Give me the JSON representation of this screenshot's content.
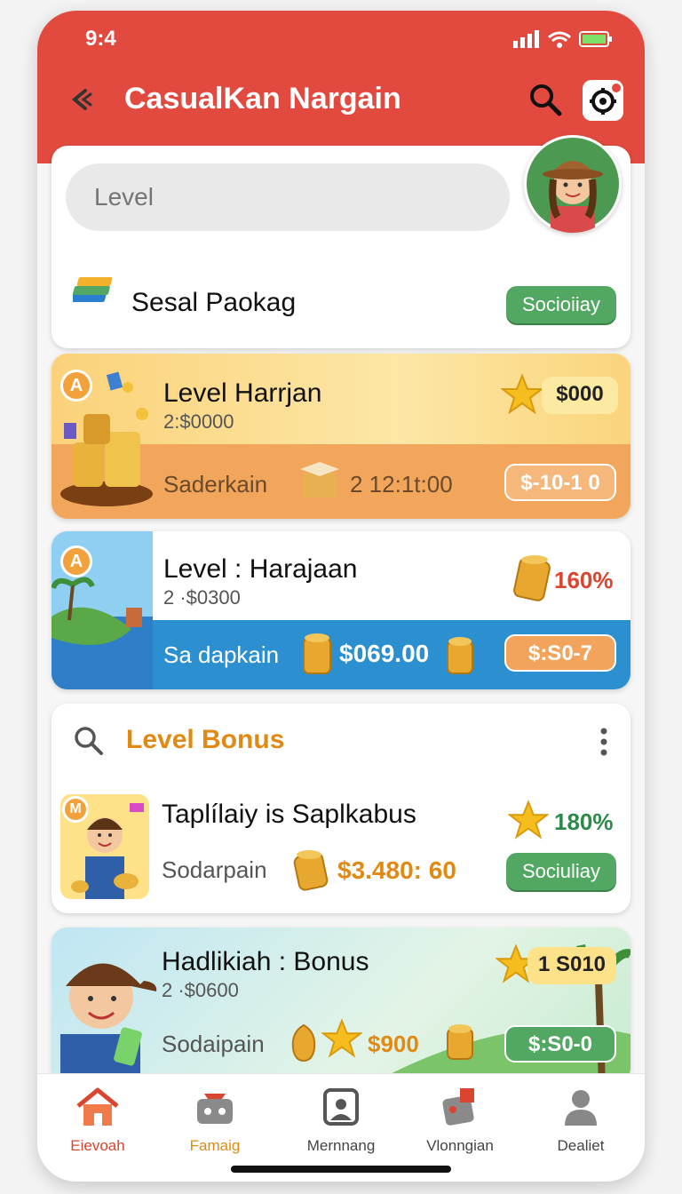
{
  "status": {
    "time": "9:4"
  },
  "header": {
    "title": "CasualKan Nargain"
  },
  "search": {
    "placeholder": "Level"
  },
  "package": {
    "label": "Sesal Paokag",
    "button": "Socioiiay"
  },
  "offers": [
    {
      "badge": "A",
      "title": "Level Harrjan",
      "price": "2:$0000",
      "strip_label": "Saderkain",
      "strip_value": "2 12:1t:00",
      "reward": "$000",
      "pill": "$-10-1 0"
    },
    {
      "badge": "A",
      "title": "Level : Harajaan",
      "price": "2 ·$0300",
      "strip_label": "Sa dapkain",
      "strip_value": "$069.00",
      "reward": "160%",
      "pill": "$:S0-7"
    }
  ],
  "bonus": {
    "title": "Level Bonus",
    "item": {
      "badge": "M",
      "title": "Taplílaiy is Saplkabus",
      "label": "Sodarpain",
      "value": "$3.480: 60",
      "reward": "180%",
      "button": "Sociuliay"
    }
  },
  "promo": {
    "title": "Hadlikiah : Bonus",
    "price": "2 ·$0600",
    "label": "Sodaipain",
    "value": "$900",
    "reward": "1 S010",
    "pill": "$:S0-0"
  },
  "nav": [
    {
      "label": "Eievoah",
      "icon": "home-icon",
      "color": "#d9452f"
    },
    {
      "label": "Famaig",
      "icon": "shop-icon",
      "color": "#e08a14"
    },
    {
      "label": "Mernnang",
      "icon": "photo-icon",
      "color": "#444444"
    },
    {
      "label": "Vlonngian",
      "icon": "gift-icon",
      "color": "#444444"
    },
    {
      "label": "Dealiet",
      "icon": "profile-icon",
      "color": "#444444"
    }
  ],
  "colors": {
    "header": "#e24a3f",
    "accent_orange": "#e08a14",
    "accent_green": "#52a862",
    "accent_blue": "#2b8fd0"
  }
}
